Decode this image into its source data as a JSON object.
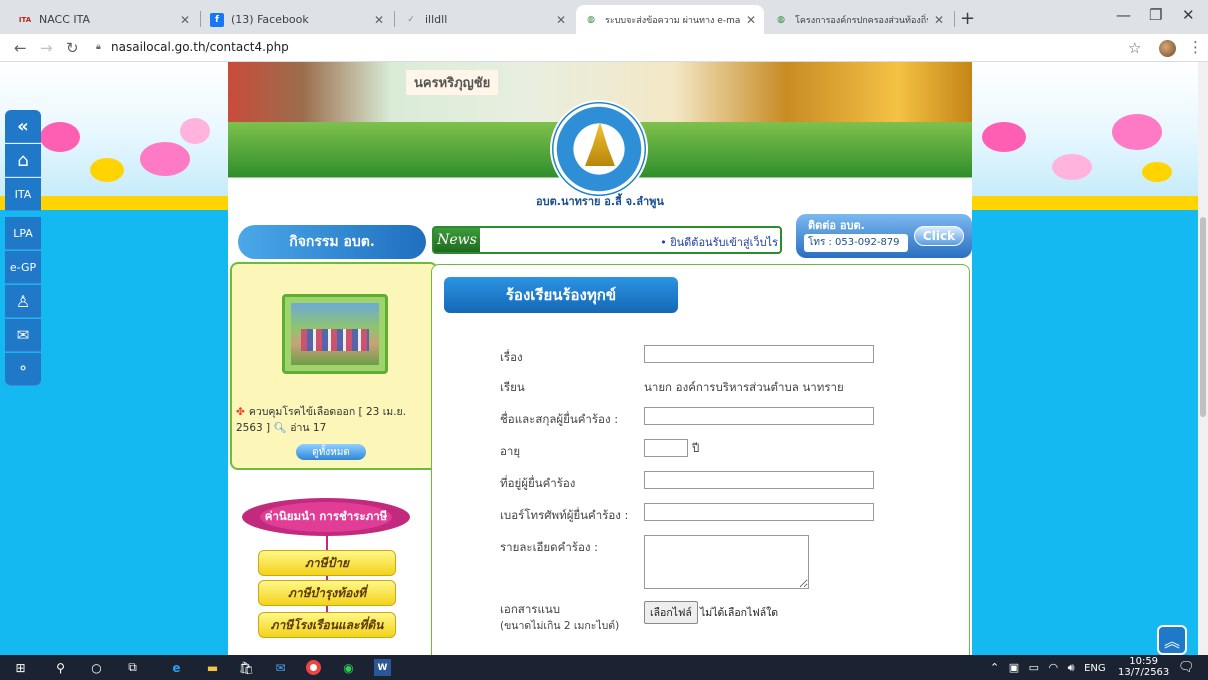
{
  "browser": {
    "tabs": [
      {
        "title": "NACC ITA",
        "favicon": "ITA",
        "active": false
      },
      {
        "title": "(13) Facebook",
        "favicon": "f",
        "active": false
      },
      {
        "title": "illdll",
        "favicon": "✓",
        "active": false
      },
      {
        "title": "ระบบจะส่งข้อความ ผ่านทาง e-mail",
        "favicon": "◍",
        "active": true
      },
      {
        "title": "โครงการองค์กรปกครองส่วนท้องถิ่น",
        "favicon": "◍",
        "active": false
      }
    ],
    "new_tab": "+",
    "url": "nasailocal.go.th/contact4.php"
  },
  "site": {
    "sign_text": "นครหริภุญชัย",
    "banner_caption": "อบต.นาทราย อ.ลี้ จ.ลำพูน",
    "left_tools": [
      "«",
      "⌂",
      "ITA",
      "LPA",
      "e-GP",
      "♙",
      "✉",
      "⚬"
    ],
    "activity_title": "กิจกรรม อบต.",
    "news_label": "News",
    "news_ticker": "• ยินดีต้อนรับเข้าสู่เว็บไร",
    "contact": {
      "title": "ติดต่อ อบต.",
      "phone": "โทร : 053-092-879",
      "click_label": "Click"
    },
    "news_item": {
      "text": "ควบคุมโรคไข้เลือดออก [ 23 เม.ย. 2563 ]",
      "reads": "อ่าน 17",
      "all_label": "ดูทั้งหมด"
    },
    "slogan": "ค่านิยมนำ การชำระภาษี",
    "tax_buttons": [
      "ภาษีป้าย",
      "ภาษีบำรุงท้องที่",
      "ภาษีโรงเรือนและที่ดิน"
    ]
  },
  "form": {
    "title": "ร้องเรียนร้องทุกข์",
    "fields": {
      "subject_label": "เรื่อง",
      "subject_value": "",
      "to_label": "เรียน",
      "to_value": "นายก องค์การบริหารส่วนตำบล นาทราย",
      "name_label": "ชื่อและสกุลผู้ยื่นคำร้อง :",
      "name_value": "",
      "age_label": "อายุ",
      "age_value": "",
      "age_unit": "ปี",
      "address_label": "ที่อยู่ผู้ยื่นคำร้อง",
      "address_value": "",
      "phone_label": "เบอร์โทรศัพท์ผู้ยื่นคำร้อง :",
      "phone_value": "",
      "detail_label": "รายละเอียดคำร้อง :",
      "detail_value": "",
      "attach_label": "เอกสารแนบ",
      "attach_note": "(ขนาดไม่เกิน 2 เมกะไบต์)",
      "file_button": "เลือกไฟล์",
      "file_status": "ไม่ได้เลือกไฟล์ใด"
    }
  },
  "taskbar": {
    "language": "ENG",
    "time": "10:59",
    "date": "13/7/2563"
  },
  "colors": {
    "page_bg": "#13b9f0",
    "primary_blue": "#1f78c8",
    "panel_border": "#6dbb3c",
    "tax_button": "#f2d21b"
  }
}
